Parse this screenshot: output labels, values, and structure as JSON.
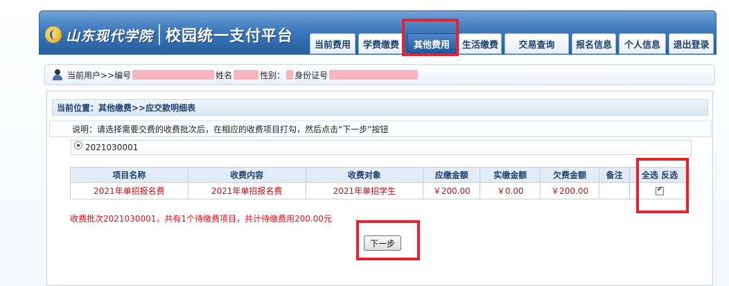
{
  "header": {
    "logo_text": "山东现代学院",
    "platform_title": "校园统一支付平台",
    "nav": [
      {
        "label": "当前费用",
        "active": false
      },
      {
        "label": "学费缴费",
        "active": false
      },
      {
        "label": "其他费用",
        "active": true
      },
      {
        "label": "生活缴费",
        "active": false
      },
      {
        "label": "交易查询",
        "active": false
      },
      {
        "label": "报名信息",
        "active": false
      },
      {
        "label": "个人信息",
        "active": false
      },
      {
        "label": "退出登录",
        "active": false
      }
    ]
  },
  "userbar": {
    "prefix": "当前用户>>编号",
    "name_label": "姓名",
    "gender_label": "性别：",
    "id_label": "身份证号"
  },
  "location": "当前位置：其他缴费>>应交款明细表",
  "note": "说明：请选择需要交费的收费批次后，在相应的收费项目打勾，然后点击“下一步”按钮",
  "batch": {
    "value": "2021030001",
    "selected": true
  },
  "table": {
    "headers": [
      "项目名称",
      "收费内容",
      "收费对象",
      "应缴金额",
      "实缴金额",
      "欠费金额",
      "备注"
    ],
    "select_all": "全选",
    "invert": "反选",
    "rows": [
      {
        "cells": [
          "2021年单招报名费",
          "2021年单招报名费",
          "2021年单招学生",
          "￥200.00",
          "￥0.00",
          "￥200.00",
          ""
        ],
        "checked": true
      }
    ]
  },
  "summary": "收费批次2021030001，共有1个待缴费项目，共计待缴费用200.00元",
  "next_button": "下一步",
  "colors": {
    "header_blue": "#3d79bd",
    "highlight_red": "#e8222a",
    "amount_red": "#b3141b"
  }
}
